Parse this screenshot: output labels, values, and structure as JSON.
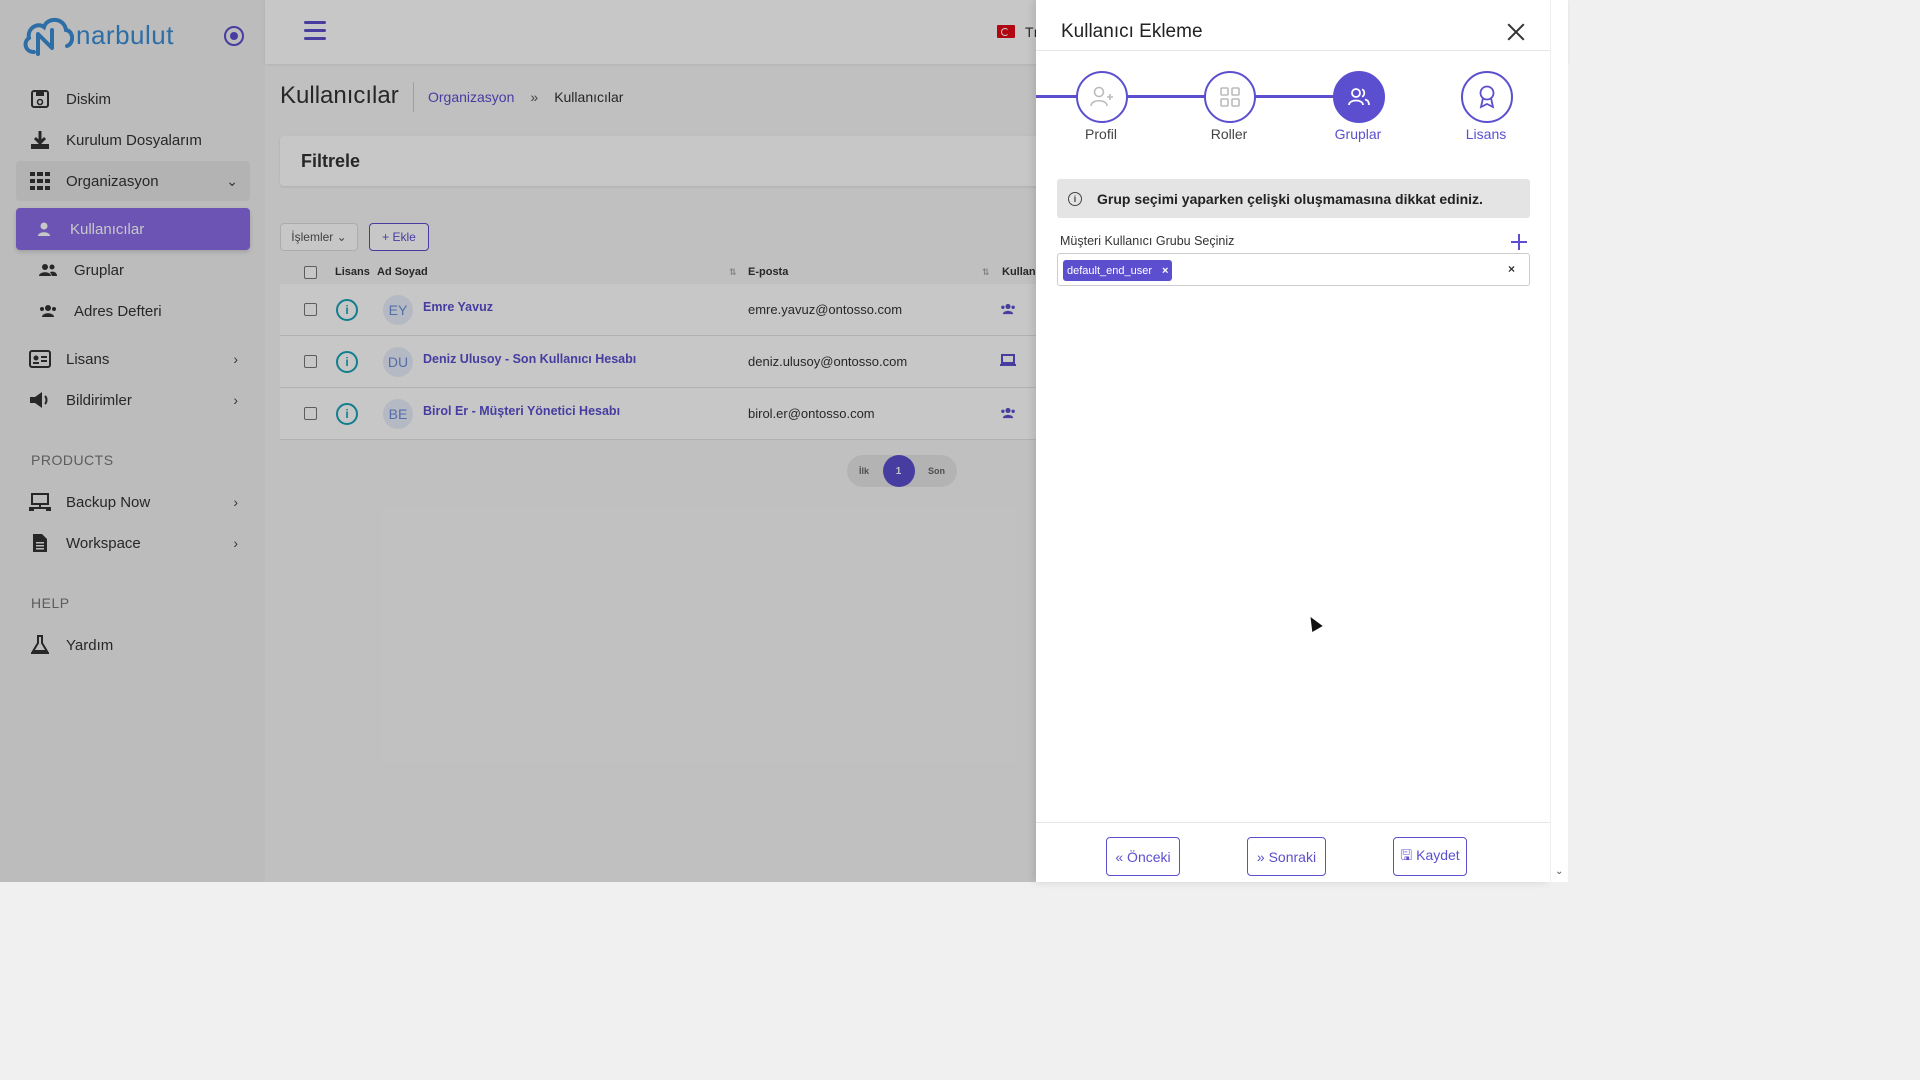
{
  "brand": {
    "logo_text": "narbulut"
  },
  "sidebar": {
    "items": [
      {
        "label": "Diskim",
        "icon": "floppy-icon"
      },
      {
        "label": "Kurulum Dosyalarım",
        "icon": "download-icon"
      },
      {
        "label": "Organizasyon",
        "icon": "grid-icon"
      },
      {
        "label": "Kullanıcılar",
        "icon": "user-icon"
      },
      {
        "label": "Gruplar",
        "icon": "users-icon"
      },
      {
        "label": "Adres Defteri",
        "icon": "address-book-icon"
      },
      {
        "label": "Lisans",
        "icon": "id-card-icon"
      },
      {
        "label": "Bildirimler",
        "icon": "megaphone-icon"
      },
      {
        "label": "Backup Now",
        "icon": "network-icon"
      },
      {
        "label": "Workspace",
        "icon": "document-icon"
      },
      {
        "label": "Yardım",
        "icon": "flask-icon"
      }
    ],
    "section_products": "PRODUCTS",
    "section_help": "HELP"
  },
  "topbar": {
    "lang_short": "Tı"
  },
  "page": {
    "title": "Kullanıcılar",
    "breadcrumb": {
      "parent": "Organizasyon",
      "sep": "»",
      "current": "Kullanıcılar"
    },
    "filter_title": "Filtrele",
    "ops_label": "İşlemler ⌄",
    "add_label": "+ Ekle"
  },
  "table": {
    "headers": {
      "license": "Lisans",
      "name": "Ad Soyad",
      "email": "E-posta",
      "type": "Kullanı"
    },
    "rows": [
      {
        "initials": "EY",
        "name": "Emre Yavuz",
        "email": "emre.yavuz@ontosso.com"
      },
      {
        "initials": "DU",
        "name": "Deniz Ulusoy - Son Kullanıcı Hesabı",
        "email": "deniz.ulusoy@ontosso.com"
      },
      {
        "initials": "BE",
        "name": "Birol Er - Müşteri Yönetici Hesabı",
        "email": "birol.er@ontosso.com"
      }
    ]
  },
  "pager": {
    "first": "İlk",
    "current": "1",
    "last": "Son"
  },
  "drawer": {
    "title": "Kullanıcı Ekleme",
    "steps": [
      "Profil",
      "Roller",
      "Gruplar",
      "Lisans"
    ],
    "alert": "Grup seçimi yaparken çelişki oluşmamasına dikkat ediniz.",
    "alert_icon": "i",
    "field_label": "Müşteri Kullanıcı Grubu Seçiniz",
    "selected_tag": "default_end_user",
    "tag_remove": "×",
    "clear": "×",
    "buttons": {
      "prev": "« Önceki",
      "next": "» Sonraki",
      "save": "🖫 Kaydet"
    }
  },
  "colors": {
    "accent": "#5b4fcf",
    "active_nav": "#8a6ce6",
    "info": "#17a2b8"
  }
}
